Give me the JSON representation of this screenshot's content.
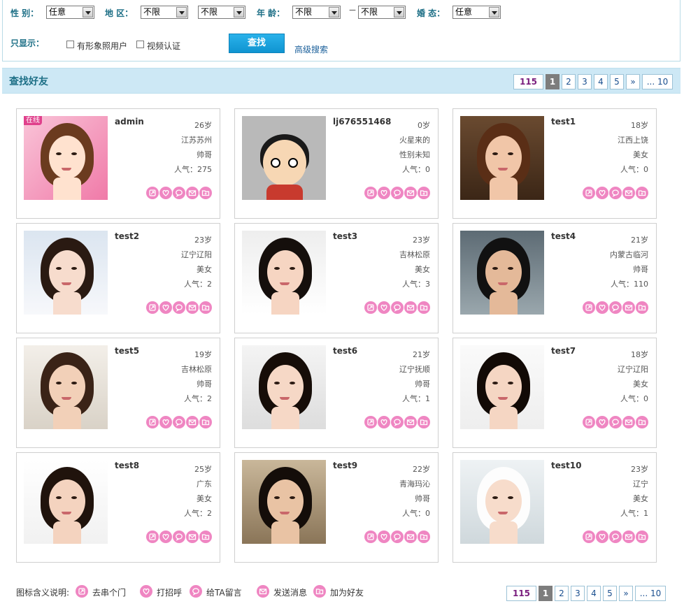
{
  "search": {
    "gender_label": "性 别：",
    "gender_value": "任意",
    "region_label": "地 区：",
    "region_value1": "不限",
    "region_value2": "不限",
    "age_label": "年 龄：",
    "age_from": "不限",
    "age_sep": "－",
    "age_to": "不限",
    "marital_label": "婚 态：",
    "marital_value": "任意",
    "only_show_label": "只显示：",
    "cb_photo_label": "有形象照用户",
    "cb_video_label": "视频认证",
    "find_button": "查找",
    "advanced_link": "高级搜索"
  },
  "bar": {
    "title": "查找好友"
  },
  "pager": {
    "total": "115",
    "pages": [
      "1",
      "2",
      "3",
      "4",
      "5"
    ],
    "current": "1",
    "next": "»",
    "last": "... 10"
  },
  "users": [
    {
      "name": "admin",
      "age": "26岁",
      "region": "江苏苏州",
      "type": "帅哥",
      "popularity": "人气：275",
      "online": "在线"
    },
    {
      "name": "lj676551468",
      "age": "0岁",
      "region": "火星来的",
      "type": "性别未知",
      "popularity": "人气：0"
    },
    {
      "name": "test1",
      "age": "18岁",
      "region": "江西上饶",
      "type": "美女",
      "popularity": "人气：0"
    },
    {
      "name": "test2",
      "age": "23岁",
      "region": "辽宁辽阳",
      "type": "美女",
      "popularity": "人气：2"
    },
    {
      "name": "test3",
      "age": "23岁",
      "region": "吉林松原",
      "type": "美女",
      "popularity": "人气：3"
    },
    {
      "name": "test4",
      "age": "21岁",
      "region": "内蒙古临河",
      "type": "帅哥",
      "popularity": "人气：110"
    },
    {
      "name": "test5",
      "age": "19岁",
      "region": "吉林松原",
      "type": "帅哥",
      "popularity": "人气：2"
    },
    {
      "name": "test6",
      "age": "21岁",
      "region": "辽宁抚顺",
      "type": "帅哥",
      "popularity": "人气：1"
    },
    {
      "name": "test7",
      "age": "18岁",
      "region": "辽宁辽阳",
      "type": "美女",
      "popularity": "人气：0"
    },
    {
      "name": "test8",
      "age": "25岁",
      "region": "广东",
      "type": "美女",
      "popularity": "人气：2"
    },
    {
      "name": "test9",
      "age": "22岁",
      "region": "青海玛沁",
      "type": "帅哥",
      "popularity": "人气：0"
    },
    {
      "name": "test10",
      "age": "23岁",
      "region": "辽宁",
      "type": "美女",
      "popularity": "人气：1"
    }
  ],
  "legend": {
    "title": "图标含义说明:",
    "items": [
      "去串个门",
      "打招呼",
      "给TA留言",
      "发送消息",
      "加为好友"
    ]
  },
  "colors": {
    "accent": "#1d6f86",
    "bar_bg": "#cde8f5",
    "action_pink": "#ef86c2",
    "button_blue": "#1aa3de"
  }
}
